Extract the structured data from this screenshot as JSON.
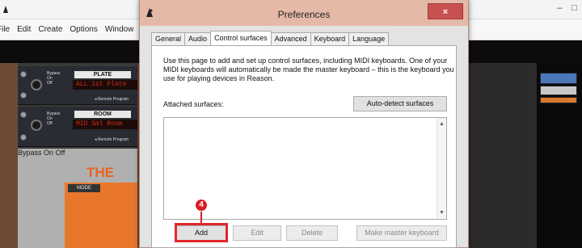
{
  "background_app": {
    "menu": [
      "File",
      "Edit",
      "Create",
      "Options",
      "Window"
    ],
    "window_controls": [
      "–",
      "□"
    ],
    "devices": [
      {
        "bypass_labels": [
          "Bypass",
          "On",
          "Off"
        ],
        "name": "PLATE",
        "lcd": "ALL 1st Plate",
        "remote": "◂ Remote Program"
      },
      {
        "bypass_labels": [
          "Bypass",
          "On",
          "Off"
        ],
        "name": "ROOM",
        "lcd": "MID Sml Room",
        "remote": "◂ Remote Program"
      }
    ],
    "synth": {
      "logo": "THE",
      "mode": "MODE",
      "bypass_labels": [
        "Bypass",
        "On",
        "Off"
      ]
    }
  },
  "dialog": {
    "title": "Preferences",
    "close_label": "×",
    "tabs": [
      {
        "label": "General",
        "active": false
      },
      {
        "label": "Audio",
        "active": false
      },
      {
        "label": "Control surfaces",
        "active": true
      },
      {
        "label": "Advanced",
        "active": false
      },
      {
        "label": "Keyboard",
        "active": false
      },
      {
        "label": "Language",
        "active": false
      }
    ],
    "intro_text": "Use this page to add and set up control surfaces, including MIDI keyboards. One of your MIDI keyboards will automatically be made the master keyboard – this is the keyboard you use for playing devices in Reason.",
    "attached_label": "Attached surfaces:",
    "auto_detect_label": "Auto-detect surfaces",
    "scroll_up": "▲",
    "scroll_down": "▼",
    "buttons": {
      "add": "Add",
      "edit": "Edit",
      "delete": "Delete",
      "make_master": "Make master keyboard"
    },
    "step_marker": "4"
  },
  "colors": {
    "highlight": "#e0282c",
    "titlebar": "#e5b9a8",
    "close": "#c75050"
  }
}
